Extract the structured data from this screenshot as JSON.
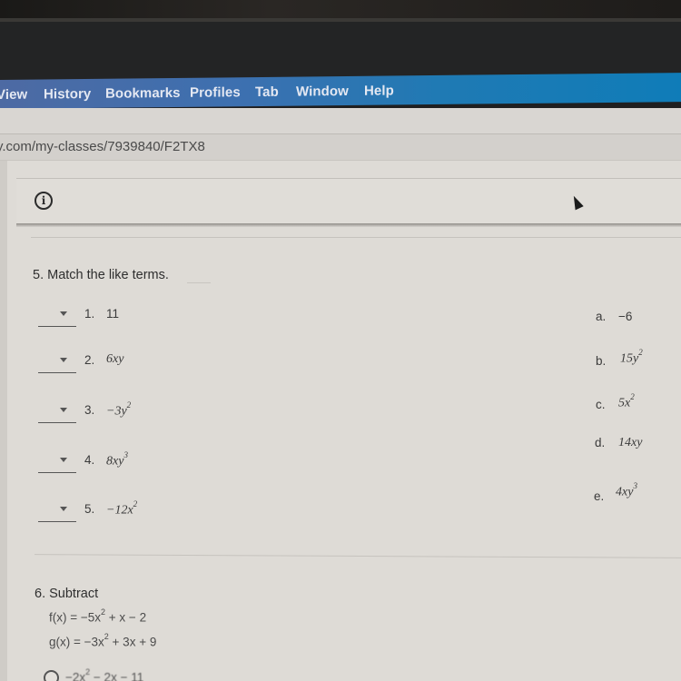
{
  "menubar": {
    "items": [
      "View",
      "History",
      "Bookmarks",
      "Profiles",
      "Tab",
      "Window",
      "Help"
    ]
  },
  "address_bar": {
    "url": "y.com/my-classes/7939840/F2TX8"
  },
  "info_bar": {
    "icon": "info-icon"
  },
  "question5": {
    "title": "5. Match the like terms.",
    "left_items": [
      {
        "number": "1.",
        "term": "11",
        "selected": ""
      },
      {
        "number": "2.",
        "term": "6xy",
        "selected": ""
      },
      {
        "number": "3.",
        "term": "−3y",
        "exp": "2",
        "selected": ""
      },
      {
        "number": "4.",
        "term": "8xy",
        "exp": "3",
        "selected": ""
      },
      {
        "number": "5.",
        "term": "−12x",
        "exp": "2",
        "selected": ""
      }
    ],
    "right_items": [
      {
        "letter": "a.",
        "term": "−6"
      },
      {
        "letter": "b.",
        "term": "15y",
        "exp": "2"
      },
      {
        "letter": "c.",
        "term": "5x",
        "exp": "2"
      },
      {
        "letter": "d.",
        "term": "14xy"
      },
      {
        "letter": "e.",
        "term": "4xy",
        "exp": "3"
      }
    ]
  },
  "question6": {
    "title": "6. Subtract",
    "f_prefix": "f(x) = −5x",
    "f_exp": "2",
    "f_suffix": " + x − 2",
    "g_prefix": "g(x) = −3x",
    "g_exp": "2",
    "g_suffix": " + 3x + 9",
    "options": [
      {
        "prefix": "−2x",
        "exp": "2",
        "suffix": " − 2x − 11"
      }
    ]
  }
}
